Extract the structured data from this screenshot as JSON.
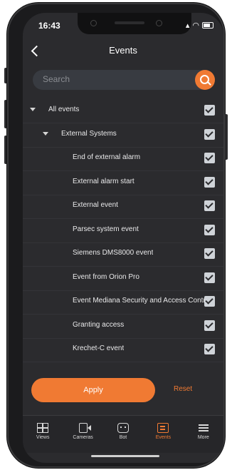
{
  "status_bar": {
    "time": "16:43"
  },
  "header": {
    "title": "Events"
  },
  "search": {
    "placeholder": "Search"
  },
  "events_tree": [
    {
      "label": "All events",
      "level": 0,
      "expanded": true,
      "checked": true
    },
    {
      "label": "External Systems",
      "level": 1,
      "expanded": true,
      "checked": true
    },
    {
      "label": "End of external alarm",
      "level": 2,
      "checked": true
    },
    {
      "label": "External alarm start",
      "level": 2,
      "checked": true
    },
    {
      "label": "External event",
      "level": 2,
      "checked": true
    },
    {
      "label": "Parsec system event",
      "level": 2,
      "checked": true
    },
    {
      "label": "Siemens DMS8000 event",
      "level": 2,
      "checked": true
    },
    {
      "label": "Event from Orion Pro",
      "level": 2,
      "checked": true
    },
    {
      "label": "Event Mediana Security and Access Contr...",
      "level": 2,
      "checked": true
    },
    {
      "label": "Granting access",
      "level": 2,
      "checked": true
    },
    {
      "label": "Krechet-C event",
      "level": 2,
      "checked": true
    }
  ],
  "actions": {
    "apply_label": "Apply",
    "reset_label": "Reset"
  },
  "tabs": [
    {
      "label": "Views",
      "icon": "grid-icon"
    },
    {
      "label": "Cameras",
      "icon": "camera-icon"
    },
    {
      "label": "Bot",
      "icon": "bot-icon"
    },
    {
      "label": "Events",
      "icon": "events-icon",
      "active": true
    },
    {
      "label": "More",
      "icon": "menu-icon"
    }
  ],
  "colors": {
    "accent": "#f07a33",
    "background": "#2b2b2e"
  }
}
